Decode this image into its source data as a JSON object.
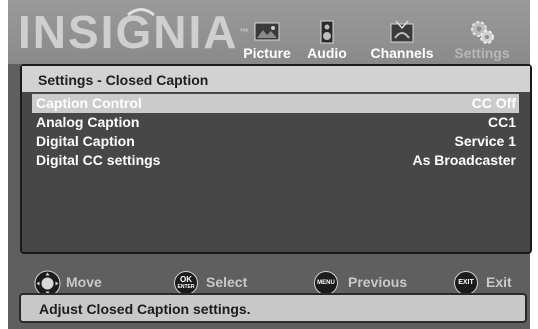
{
  "brand": {
    "name": "INSIGNIA",
    "trademark": "™"
  },
  "tabs": [
    {
      "label": "Picture",
      "icon": "picture-icon",
      "active": false
    },
    {
      "label": "Audio",
      "icon": "speaker-icon",
      "active": false
    },
    {
      "label": "Channels",
      "icon": "antenna-icon",
      "active": false
    },
    {
      "label": "Settings",
      "icon": "gears-icon",
      "active": true
    }
  ],
  "panel": {
    "title": "Settings - Closed Caption",
    "rows": [
      {
        "label": "Caption  Control",
        "value": "CC Off",
        "selected": true
      },
      {
        "label": "Analog Caption",
        "value": "CC1",
        "selected": false
      },
      {
        "label": "Digital Caption",
        "value": "Service 1",
        "selected": false
      },
      {
        "label": "Digital CC settings",
        "value": "As Broadcaster",
        "selected": false
      }
    ]
  },
  "footer": {
    "hints": [
      {
        "key": "dpad",
        "key_text": "",
        "label": "Move"
      },
      {
        "key": "ok",
        "key_text": "OK",
        "key_subtext": "ENTER",
        "label": "Select"
      },
      {
        "key": "menu",
        "key_text": "MENU",
        "label": "Previous"
      },
      {
        "key": "exit",
        "key_text": "EXIT",
        "label": "Exit"
      }
    ]
  },
  "status": {
    "text": "Adjust  Closed Caption settings."
  },
  "colors": {
    "background": "#5f5f5f",
    "header": "#8f8f8f",
    "panel": "#474747",
    "panel_title_bar": "#d2d2d2",
    "selected_row": "#cbcbcb",
    "status_bar": "#c8c8c8"
  }
}
